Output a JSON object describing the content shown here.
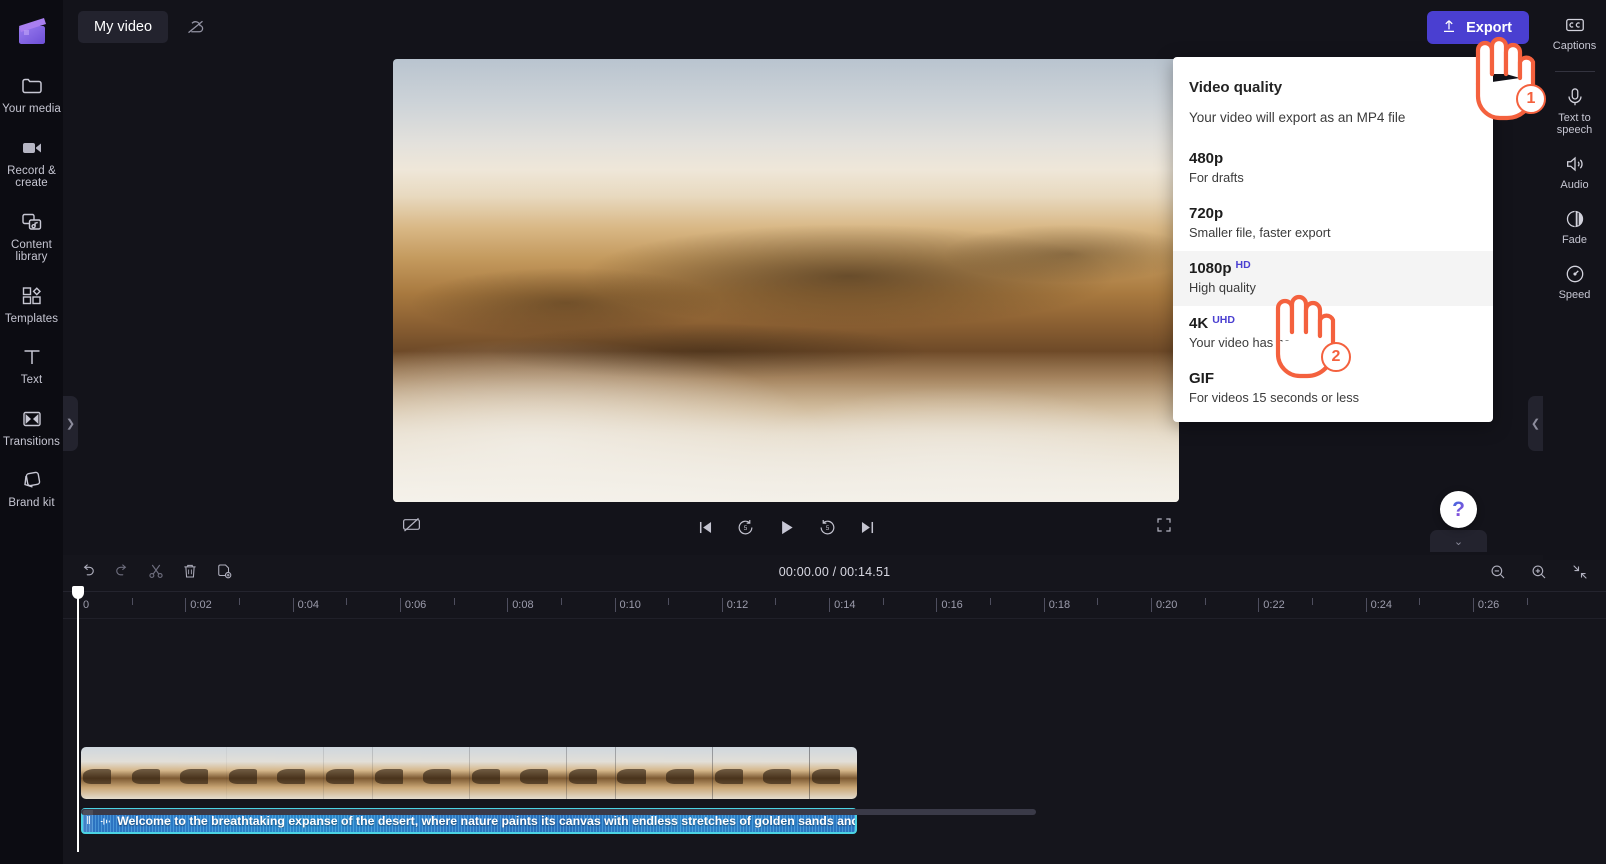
{
  "app": {
    "name": "Clipchamp video editor"
  },
  "topbar": {
    "project_title": "My video",
    "cloud_icon": "cloud-off-icon",
    "export_label": "Export",
    "export_icon": "upload-arrow-icon",
    "export_color": "#4a3fd1"
  },
  "left_rail": {
    "logo_icon": "clapperboard-logo-icon",
    "items": [
      {
        "label": "Your media",
        "icon": "folder-icon"
      },
      {
        "label": "Record & create",
        "icon": "video-camera-icon"
      },
      {
        "label": "Content library",
        "icon": "media-stack-icon"
      },
      {
        "label": "Templates",
        "icon": "templates-grid-icon"
      },
      {
        "label": "Text",
        "icon": "text-t-icon"
      },
      {
        "label": "Transitions",
        "icon": "transitions-icon"
      },
      {
        "label": "Brand kit",
        "icon": "brand-kit-icon"
      }
    ],
    "collapse_chevron": "chevron-right-icon"
  },
  "right_rail": {
    "items": [
      {
        "label": "Captions",
        "icon": "closed-captions-icon"
      },
      {
        "label": "Text to speech",
        "icon": "speech-icon"
      },
      {
        "label": "Audio",
        "icon": "speaker-icon"
      },
      {
        "label": "Fade",
        "icon": "fade-circle-icon"
      },
      {
        "label": "Speed",
        "icon": "speedometer-icon"
      }
    ],
    "collapse_chevron": "chevron-left-icon"
  },
  "preview": {
    "subtitle_toggle_icon": "captions-off-icon",
    "fullscreen_icon": "fullscreen-icon",
    "controls": [
      {
        "name": "skip-to-start",
        "icon": "skip-back-icon"
      },
      {
        "name": "rewind-5-seconds",
        "icon": "rewind-5-icon"
      },
      {
        "name": "play",
        "icon": "play-icon"
      },
      {
        "name": "forward-5-seconds",
        "icon": "forward-5-icon"
      },
      {
        "name": "skip-to-end",
        "icon": "skip-forward-icon"
      }
    ]
  },
  "export_dropdown": {
    "title": "Video quality",
    "subtitle": "Your video will export as an MP4 file",
    "options": [
      {
        "name": "480p",
        "badge": "",
        "desc": "For drafts",
        "selected": false
      },
      {
        "name": "720p",
        "badge": "",
        "desc": "Smaller file, faster export",
        "selected": false
      },
      {
        "name": "1080p",
        "badge": "HD",
        "desc": "High quality",
        "selected": true
      },
      {
        "name": "4K",
        "badge": "UHD",
        "desc": "Your video has no",
        "selected": false
      },
      {
        "name": "GIF",
        "badge": "",
        "desc": "For videos 15 seconds or less",
        "selected": false
      }
    ],
    "badge_color": "#4a3fd1"
  },
  "annotations": {
    "accent_color": "#f4613e",
    "steps": [
      {
        "number": "1",
        "target": "export-button"
      },
      {
        "number": "2",
        "target": "export-option-1080p"
      }
    ]
  },
  "help": {
    "icon": "question-mark-icon",
    "hide_timeline_icon": "chevron-down-icon"
  },
  "timeline": {
    "current_time": "00:00.00",
    "total_time": "00:14.51",
    "time_display": "00:00.00 / 00:14.51",
    "tools": [
      {
        "name": "undo",
        "icon": "undo-arrow-icon"
      },
      {
        "name": "redo",
        "icon": "redo-arrow-icon"
      },
      {
        "name": "split",
        "icon": "scissors-icon"
      },
      {
        "name": "delete",
        "icon": "trash-icon"
      },
      {
        "name": "duplicate",
        "icon": "duplicate-icon"
      }
    ],
    "right_tools": [
      {
        "name": "zoom-out",
        "icon": "magnifier-minus-icon"
      },
      {
        "name": "zoom-in",
        "icon": "magnifier-plus-icon"
      },
      {
        "name": "fit-to-screen",
        "icon": "fit-arrows-icon"
      }
    ],
    "ruler_labels": [
      "0",
      "0:02",
      "0:04",
      "0:06",
      "0:08",
      "0:10",
      "0:12",
      "0:14",
      "0:16",
      "0:18",
      "0:20",
      "0:22",
      "0:24",
      "0:26"
    ],
    "video_clip": {
      "name": "desert-video-clip",
      "thumbnails": 16
    },
    "caption_clip": {
      "text": "Welcome to the breathtaking expanse of the desert, where nature paints its canvas with endless stretches of golden sands and boundless",
      "icon": "audio-wave-icon",
      "border_color": "#4bd3e3",
      "selected": true
    }
  }
}
